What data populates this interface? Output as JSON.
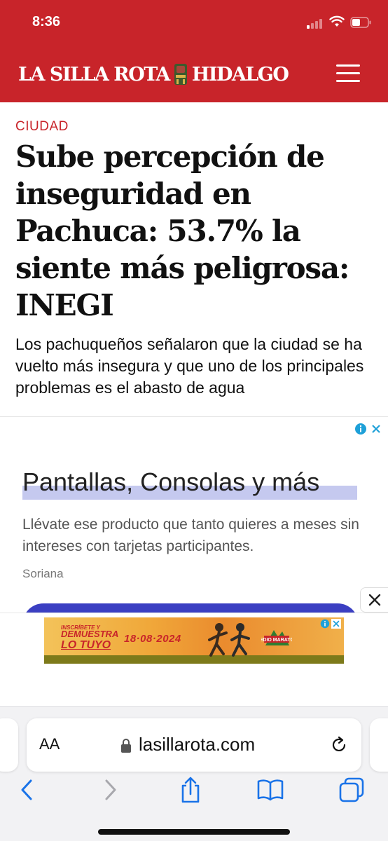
{
  "status_bar": {
    "time": "8:36"
  },
  "header": {
    "logo_left": "LA SILLA ROTA",
    "logo_right": "HIDALGO",
    "menu_icon": "hamburger-icon"
  },
  "article": {
    "category": "CIUDAD",
    "headline": "Sube percepción de inseguridad en Pachuca: 53.7% la siente más peligrosa: INEGI",
    "dek": "Los pachuqueños señalaron que la ciudad se ha vuelto más insegura y que uno de los principales problemas es el abasto de agua"
  },
  "ad": {
    "title": "Pantallas, Consolas y más",
    "description": "Llévate ese producto que tanto quieres a meses sin intereses con tarjetas participantes.",
    "brand": "Soriana",
    "button_color": "#3b3fc2"
  },
  "banner": {
    "line1": "INSCRÍBETE Y",
    "line2": "DEMUESTRA",
    "line3": "LO TUYO",
    "date": "18·08·2024",
    "badge": "MEDIO MARATÓN"
  },
  "browser": {
    "text_size_label": "AA",
    "url": "lasillarota.com"
  },
  "colors": {
    "brand_red": "#c8242a",
    "ios_blue": "#1a73e8"
  }
}
